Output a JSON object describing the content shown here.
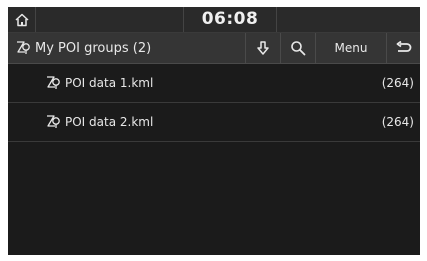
{
  "status_bar": {
    "home_icon": "home-icon",
    "clock": "06:08"
  },
  "header": {
    "title_icon": "poi-group-icon",
    "title": "My POI groups (2)",
    "buttons": {
      "download_icon": "download-icon",
      "search_icon": "search-icon",
      "menu_label": "Menu",
      "back_icon": "back-icon"
    }
  },
  "list": {
    "items": [
      {
        "icon": "poi-file-icon",
        "label": "POI data 1.kml",
        "count": "(264)"
      },
      {
        "icon": "poi-file-icon",
        "label": "POI data 2.kml",
        "count": "(264)"
      }
    ]
  },
  "colors": {
    "background": "#1b1b1b",
    "status_bar": "#2a2a2a",
    "header_bar": "#353535",
    "text": "#e8e8e8"
  }
}
